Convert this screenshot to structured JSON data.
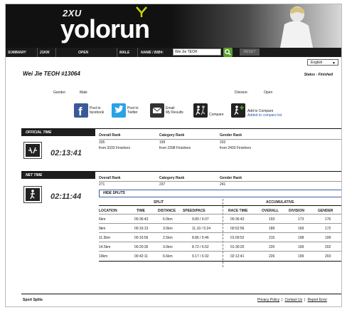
{
  "brand": {
    "tagline": "2XU",
    "name": "yolorun"
  },
  "nav": {
    "summary": "SUMMARY",
    "distance": "21KM",
    "category": "OPEN",
    "gender": "MALE",
    "search_label": "NAME / BIB#:",
    "search_value": "Wei Jie TEOH",
    "reset_label": "RESET"
  },
  "language": {
    "selected": "English"
  },
  "athlete": {
    "title": "Wei Jie TEOH  #13064",
    "status": "Status - Finished",
    "gender_label": "Gender:",
    "gender_value": "Male",
    "division_label": "Division:",
    "division_value": "Open"
  },
  "actions": {
    "facebook": [
      "Post to",
      "facebook"
    ],
    "twitter": [
      "Post to",
      "Twitter"
    ],
    "email": [
      "Email",
      "My Results"
    ],
    "compare": "Compare",
    "add_compare": [
      "Add to Compare",
      "Added to compare list"
    ]
  },
  "official": {
    "header": "OFFICIAL TIME",
    "time": "02:13:41",
    "col_labels": [
      "Overall Rank",
      "Category Rank",
      "Gender Rank"
    ],
    "values": [
      "335",
      "199",
      "202"
    ],
    "finishers": [
      "from 3333 Finishers",
      "from 2398 Finishers",
      "from 2403 Finishers"
    ]
  },
  "net": {
    "header": "NET TIME",
    "time": "02:11:44",
    "col_labels": [
      "Overall Rank",
      "Category Rank",
      "Gender Rank"
    ],
    "values": [
      "271",
      "237",
      "241"
    ]
  },
  "splits": {
    "hide_label": "HIDE SPLITS",
    "split_header": "SPLIT",
    "accum_header": "ACCUMULATIVE",
    "columns": [
      "LOCATION",
      "TIME",
      "DISTANCE",
      "SPEED/PACE",
      "RACE TIME",
      "OVERALL",
      "DIVISION",
      "GENDER"
    ],
    "rows": [
      [
        "6km",
        "00:36:43",
        "6.0km",
        "9.80 / 6:07",
        "00:36:43",
        "193",
        "173",
        "176"
      ],
      [
        "9km",
        "00:16:13",
        "3.0km",
        "11.10 / 5:24",
        "00:52:56",
        "189",
        "169",
        "172"
      ],
      [
        "11.5km",
        "00:16:56",
        "2.5km",
        "8.86 / 6:46",
        "01:09:52",
        "215",
        "198",
        "199"
      ],
      [
        "14.5km",
        "00:20:35",
        "3.0km",
        "8.72 / 6:52",
        "01:30:20",
        "220",
        "199",
        "202"
      ],
      [
        "19km",
        "00:42:11",
        "6.6km",
        "9.17 / 6:32",
        "02:12:41",
        "226",
        "199",
        "203"
      ]
    ]
  },
  "footer": {
    "left": "Sport Splits",
    "links": [
      "Privacy Policy",
      "Contact Us",
      "Report Error"
    ]
  },
  "colors": {
    "accent_green": "#5aa02c",
    "facebook": "#3b5998",
    "twitter": "#2aa3e6",
    "logo_yellow": "#c8d400"
  }
}
